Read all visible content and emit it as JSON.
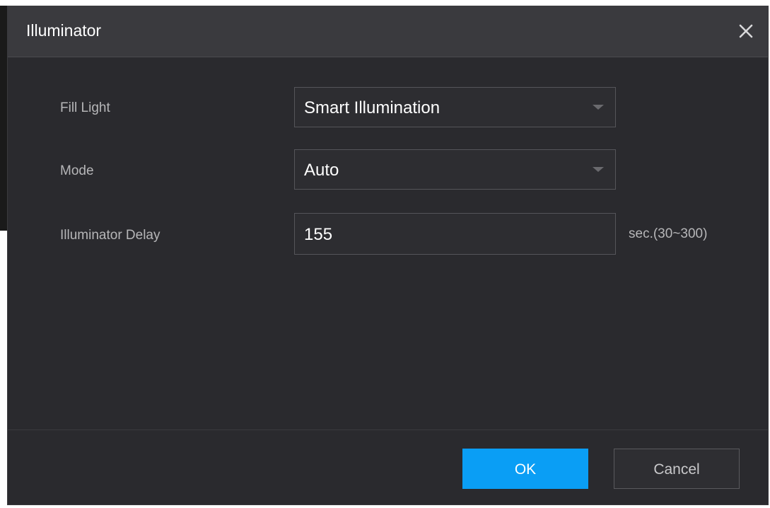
{
  "dialog": {
    "title": "Illuminator",
    "close_icon": "close-icon"
  },
  "form": {
    "fill_light": {
      "label": "Fill Light",
      "value": "Smart Illumination"
    },
    "mode": {
      "label": "Mode",
      "value": "Auto"
    },
    "illuminator_delay": {
      "label": "Illuminator Delay",
      "value": "155",
      "unit": "sec.(30~300)"
    }
  },
  "footer": {
    "ok_label": "OK",
    "cancel_label": "Cancel"
  },
  "colors": {
    "dialog_bg": "#2a2a2e",
    "titlebar_bg": "#3a3a3e",
    "accent": "#0a9ef5",
    "label_text": "#b6b6b8"
  }
}
